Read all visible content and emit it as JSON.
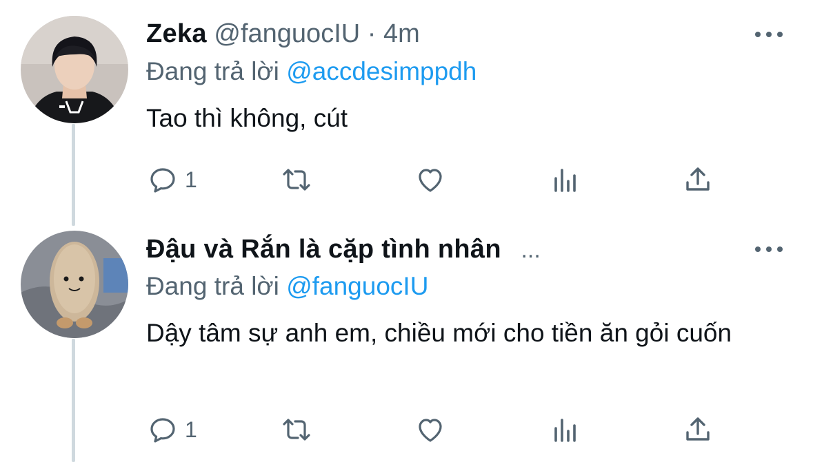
{
  "colors": {
    "text_primary": "#0f1419",
    "text_secondary": "#536471",
    "accent": "#1d9bf0",
    "thread_line": "#cfd9de"
  },
  "tweets": [
    {
      "display_name": "Zeka",
      "handle": "@fanguocIU",
      "separator": "·",
      "time": "4m",
      "reply_prefix": "Đang trả lời",
      "reply_mention": "@accdesimppdh",
      "text": "Tao thì không, cút",
      "reply_count": "1",
      "avatar": "avatar-photo-person-icon"
    },
    {
      "display_name": "Đậu và Rắn là cặp tình nhân",
      "name_overflow": "...",
      "reply_prefix": "Đang trả lời",
      "reply_mention": "@fanguocIU",
      "text": "Dậy tâm sự anh em, chiều mới cho tiền ăn gỏi cuốn",
      "reply_count": "1",
      "avatar": "avatar-plush-toy-icon"
    }
  ]
}
